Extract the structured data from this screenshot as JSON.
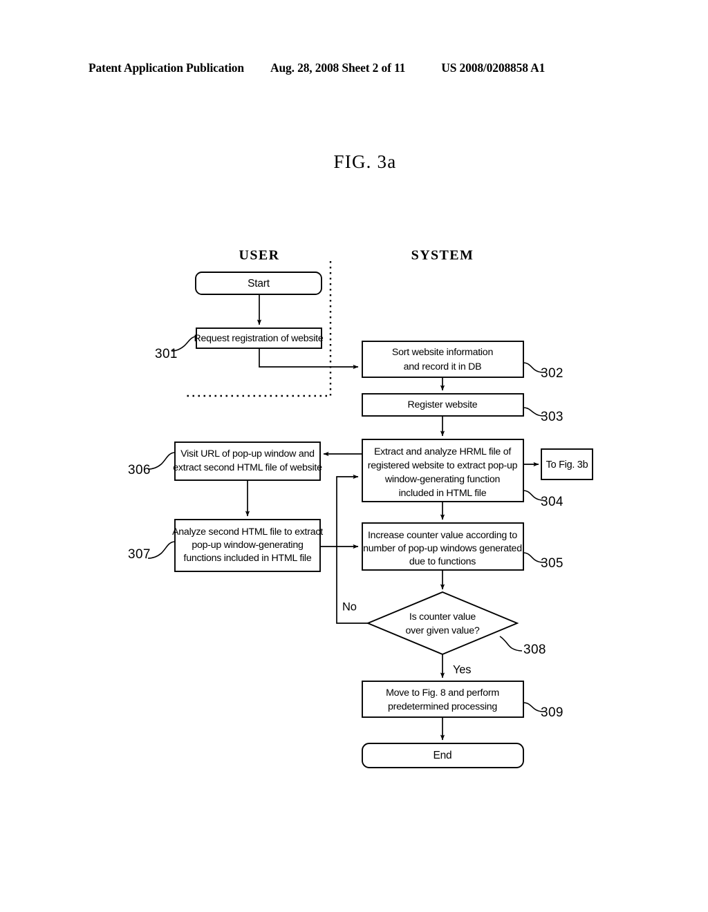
{
  "header": {
    "publication": "Patent Application Publication",
    "date_sheet": "Aug. 28, 2008  Sheet 2 of 11",
    "patent_number": "US 2008/0208858 A1"
  },
  "figure": {
    "title": "FIG. 3a",
    "columns": [
      {
        "id": "user",
        "label": "USER"
      },
      {
        "id": "system",
        "label": "SYSTEM"
      }
    ],
    "nodes": {
      "start": {
        "label": "Start",
        "shape": "terminator",
        "lane": "user"
      },
      "n301": {
        "ref": "301",
        "shape": "process",
        "lane": "user",
        "lines": [
          "Request registration of website"
        ]
      },
      "n302": {
        "ref": "302",
        "shape": "process",
        "lane": "system",
        "lines": [
          "Sort website information",
          "and record it in DB"
        ]
      },
      "n303": {
        "ref": "303",
        "shape": "process",
        "lane": "system",
        "lines": [
          "Register website"
        ]
      },
      "n304": {
        "ref": "304",
        "shape": "process",
        "lane": "system",
        "lines": [
          "Extract and analyze HRML file of",
          "registered website to extract pop-up",
          "window-generating function",
          "included in HTML file"
        ]
      },
      "n305": {
        "ref": "305",
        "shape": "process",
        "lane": "system",
        "lines": [
          "Increase counter  value according to",
          "number of pop-up windows generated",
          "due to functions"
        ]
      },
      "n306": {
        "ref": "306",
        "shape": "process",
        "lane": "user",
        "lines": [
          "Visit URL of pop-up window and",
          "extract second HTML file of website"
        ]
      },
      "n307": {
        "ref": "307",
        "shape": "process",
        "lane": "user",
        "lines": [
          "Analyze second HTML file to extract",
          "pop-up window-generating",
          "functions included in HTML file"
        ]
      },
      "n308": {
        "ref": "308",
        "shape": "decision",
        "lane": "system",
        "lines": [
          "Is counter  value",
          "over given value?"
        ]
      },
      "n309": {
        "ref": "309",
        "shape": "process",
        "lane": "system",
        "lines": [
          "Move to Fig.  8 and perform",
          "predetermined processing"
        ]
      },
      "end": {
        "label": "End",
        "shape": "terminator",
        "lane": "system"
      },
      "offpage": {
        "label": "To Fig. 3b",
        "shape": "connector",
        "lane": "system"
      }
    },
    "branch_labels": {
      "no": "No",
      "yes": "Yes"
    }
  }
}
